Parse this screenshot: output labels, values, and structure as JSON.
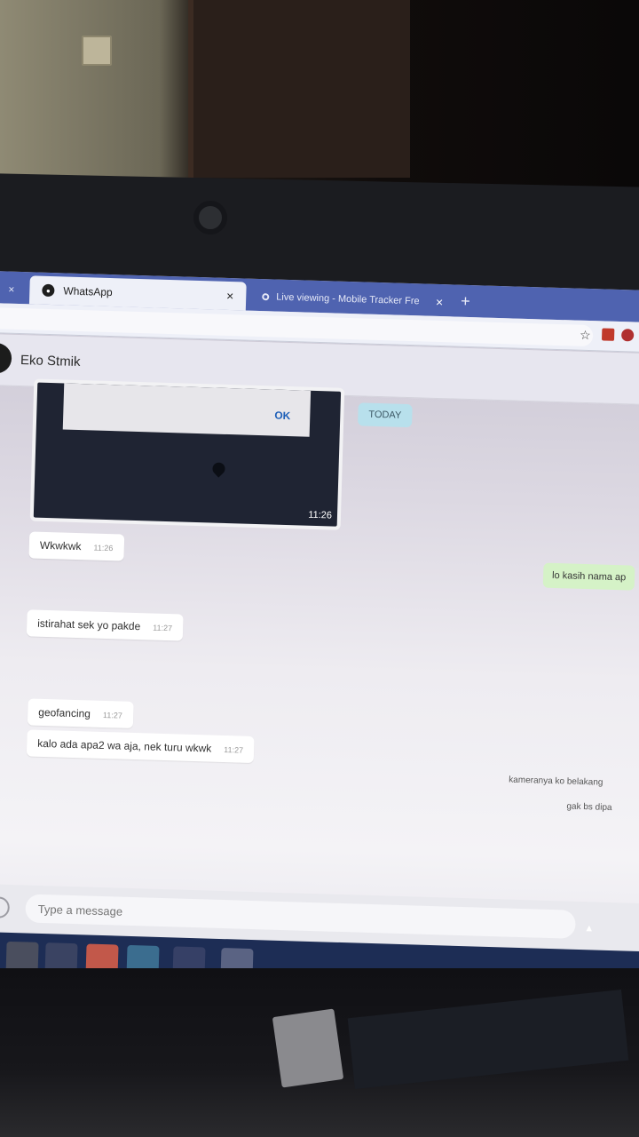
{
  "browser": {
    "tabs": [
      {
        "label": "WhatsApp",
        "active": true
      },
      {
        "label": "Live viewing - Mobile Tracker Fre",
        "active": false
      }
    ],
    "close_glyph": "×",
    "newtab_glyph": "+",
    "bookmark_glyph": "☆"
  },
  "chat": {
    "contact_name": "Eko Stmik",
    "date_badge": "TODAY",
    "image_message": {
      "dialog_button": "OK",
      "time": "11:26"
    },
    "incoming": [
      {
        "text": "Wkwkwk",
        "time": "11:26"
      },
      {
        "text": "istirahat sek yo pakde",
        "time": "11:27"
      },
      {
        "text": "geofancing",
        "time": "11:27"
      },
      {
        "text": "kalo ada apa2 wa aja, nek turu wkwk",
        "time": "11:27"
      }
    ],
    "outgoing": [
      {
        "text": "lo kasih nama ap"
      }
    ],
    "partial_right": [
      {
        "text": "kameranya ko belakang"
      },
      {
        "text": "gak bs dipa"
      }
    ]
  },
  "composer": {
    "placeholder": "Type a message"
  },
  "colors": {
    "taskbar": "#1d2d55",
    "tab_strip": "#4f63b0",
    "incoming_bubble": "#ffffff",
    "outgoing_bubble": "#d5f2c7",
    "date_badge": "#b8e0ec"
  }
}
